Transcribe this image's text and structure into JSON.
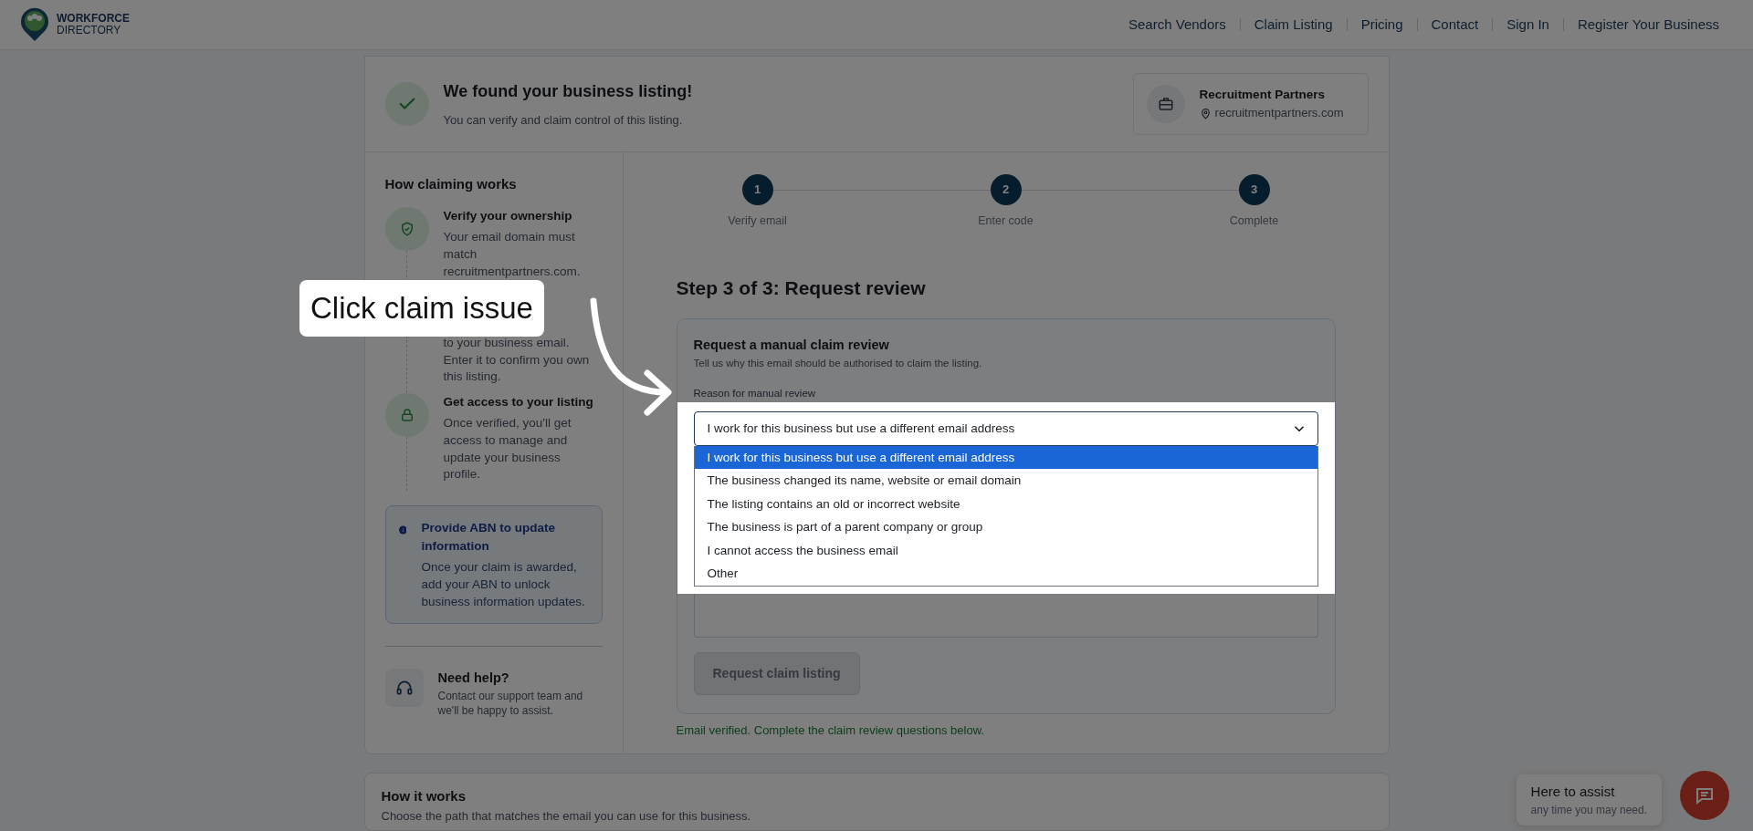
{
  "navbar": {
    "logo_lines": [
      "WORKFORCE",
      "DIRECTORY"
    ],
    "links": [
      "Search Vendors",
      "Claim Listing",
      "Pricing",
      "Contact",
      "Sign In",
      "Register Your Business"
    ]
  },
  "listing_header": {
    "title": "We found your business listing!",
    "subtitle": "You can verify and claim control of this listing.",
    "business_name": "Recruitment Partners",
    "business_website": "recruitmentpartners.com"
  },
  "sidebar": {
    "title": "How claiming works",
    "steps": [
      {
        "kind": "shield",
        "title": "Verify your ownership",
        "text": "Your email domain must match recruitmentpartners.com."
      },
      {
        "text": "to your business email. Enter it to confirm you own this listing."
      },
      {
        "kind": "lock",
        "title": "Get access to your listing",
        "text": "Once verified, you'll get access to manage and update your business profile."
      }
    ],
    "info": {
      "title": "Provide ABN to update information",
      "text": "Once your claim is awarded, add your ABN to unlock business information updates."
    },
    "help": {
      "title": "Need help?",
      "text": "Contact our support team and we'll be happy to assist."
    }
  },
  "stepper": [
    {
      "number": "1",
      "label": "Verify email"
    },
    {
      "number": "2",
      "label": "Enter code"
    },
    {
      "number": "3",
      "label": "Complete"
    }
  ],
  "form": {
    "heading": "Step 3 of 3: Request review",
    "card_title": "Request a manual claim review",
    "card_subtitle": "Tell us why this email should be authorised to claim the listing.",
    "label": "Reason for manual review",
    "value": "I work for this business but use a different email address",
    "options": [
      {
        "label": "I work for this business but use a different email address",
        "selected": true
      },
      {
        "label": "The business changed its name, website or email domain",
        "selected": false
      },
      {
        "label": "The listing contains an old or incorrect website",
        "selected": false
      },
      {
        "label": "The business is part of a parent company or group",
        "selected": false
      },
      {
        "label": "I cannot access the business email",
        "selected": false
      },
      {
        "label": "Other",
        "selected": false
      }
    ],
    "button": "Request claim listing",
    "button_disabled": true,
    "status": "Email verified. Complete the claim review questions below."
  },
  "how_it_works": {
    "title": "How it works",
    "text": "Choose the path that matches the email you can use for this business."
  },
  "chat": {
    "title": "Here to assist",
    "text": "any time you may need."
  },
  "annotation": {
    "text": "Click claim issue"
  }
}
